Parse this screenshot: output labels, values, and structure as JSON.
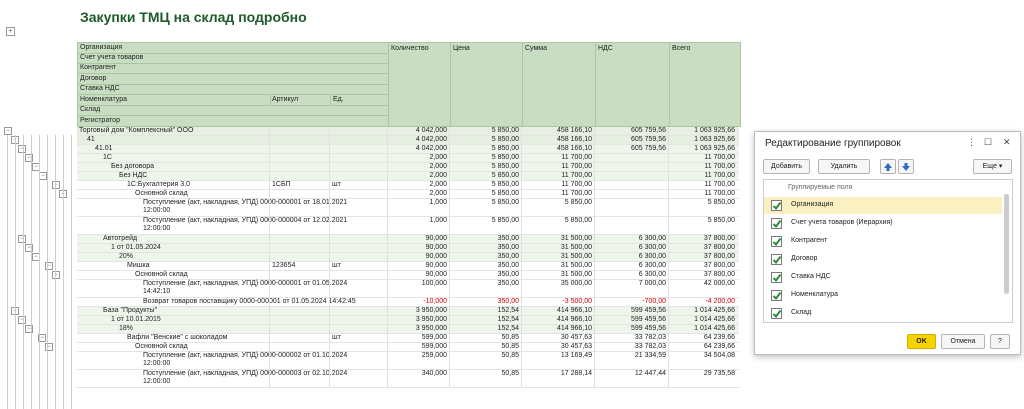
{
  "report": {
    "title": "Закупки ТМЦ на склад подробно",
    "expand_all": "+",
    "header": {
      "org": "Организация",
      "account": "Счет учета товаров",
      "counterparty": "Контрагент",
      "contract": "Договор",
      "vat_rate": "Ставка НДС",
      "nomenclature": "Номенклатура",
      "article": "Артикул",
      "unit": "Ед.",
      "warehouse": "Склад",
      "registrar": "Регистратор",
      "qty": "Количество",
      "price": "Цена",
      "sum": "Сумма",
      "vat": "НДС",
      "total": "Всего"
    }
  },
  "rows": [
    {
      "name": "Торговый дом \"Комплексный\" ООО",
      "qty": "4 042,000",
      "price": "5 850,00",
      "sum": "458 166,10",
      "vat": "605 759,56",
      "total": "1 063 925,66"
    },
    {
      "name": "41",
      "qty": "4 042,000",
      "price": "5 850,00",
      "sum": "458 166,10",
      "vat": "605 759,56",
      "total": "1 063 925,66"
    },
    {
      "name": "41.01",
      "qty": "4 042,000",
      "price": "5 850,00",
      "sum": "458 166,10",
      "vat": "605 759,56",
      "total": "1 063 925,66"
    },
    {
      "name": "1С",
      "qty": "2,000",
      "price": "5 850,00",
      "sum": "11 700,00",
      "vat": "",
      "total": "11 700,00"
    },
    {
      "name": "Без договора",
      "qty": "2,000",
      "price": "5 850,00",
      "sum": "11 700,00",
      "vat": "",
      "total": "11 700,00"
    },
    {
      "name": "Без НДС",
      "qty": "2,000",
      "price": "5 850,00",
      "sum": "11 700,00",
      "vat": "",
      "total": "11 700,00"
    },
    {
      "name": "1С:Бухгалтерия 3.0",
      "article": "1СБП",
      "unit": "шт",
      "qty": "2,000",
      "price": "5 850,00",
      "sum": "11 700,00",
      "vat": "",
      "total": "11 700,00"
    },
    {
      "name": "Основной склад",
      "qty": "2,000",
      "price": "5 850,00",
      "sum": "11 700,00",
      "vat": "",
      "total": "11 700,00"
    },
    {
      "name": "Поступление (акт, накладная, УПД) 0000-000001 от 18.01.2021",
      "name2": "12:00:00",
      "qty": "1,000",
      "price": "5 850,00",
      "sum": "5 850,00",
      "vat": "",
      "total": "5 850,00"
    },
    {
      "name": "Поступление (акт, накладная, УПД) 0000-000004 от 12.02.2021",
      "name2": "12:00:00",
      "qty": "1,000",
      "price": "5 850,00",
      "sum": "5 850,00",
      "vat": "",
      "total": "5 850,00"
    },
    {
      "name": "Автотрейд",
      "qty": "90,000",
      "price": "350,00",
      "sum": "31 500,00",
      "vat": "6 300,00",
      "total": "37 800,00"
    },
    {
      "name": "1 от 01.05.2024",
      "qty": "90,000",
      "price": "350,00",
      "sum": "31 500,00",
      "vat": "6 300,00",
      "total": "37 800,00"
    },
    {
      "name": "20%",
      "qty": "90,000",
      "price": "350,00",
      "sum": "31 500,00",
      "vat": "6 300,00",
      "total": "37 800,00"
    },
    {
      "name": "Мишка",
      "article": "123654",
      "unit": "шт",
      "qty": "90,000",
      "price": "350,00",
      "sum": "31 500,00",
      "vat": "6 300,00",
      "total": "37 800,00"
    },
    {
      "name": "Основной склад",
      "qty": "90,000",
      "price": "350,00",
      "sum": "31 500,00",
      "vat": "6 300,00",
      "total": "37 800,00"
    },
    {
      "name": "Поступление (акт, накладная, УПД) 0000-000001 от 01.05.2024",
      "name2": "14:42:10",
      "qty": "100,000",
      "price": "350,00",
      "sum": "35 000,00",
      "vat": "7 000,00",
      "total": "42 000,00"
    },
    {
      "name": "Возврат товаров поставщику 0000-000001 от 01.05.2024 14:42:45",
      "qty": "-10,000",
      "price": "350,00",
      "sum": "-3 500,00",
      "vat": "-700,00",
      "total": "-4 200,00",
      "negative": true
    },
    {
      "name": "База \"Продукты\"",
      "qty": "3 950,000",
      "price": "152,54",
      "sum": "414 966,10",
      "vat": "599 459,56",
      "total": "1 014 425,66"
    },
    {
      "name": "1 от 10.01.2015",
      "qty": "3 950,000",
      "price": "152,54",
      "sum": "414 966,10",
      "vat": "599 459,56",
      "total": "1 014 425,66"
    },
    {
      "name": "18%",
      "qty": "3 950,000",
      "price": "152,54",
      "sum": "414 966,10",
      "vat": "599 459,56",
      "total": "1 014 425,66"
    },
    {
      "name": "Вафли \"Венские\" с шоколадом",
      "article": "",
      "unit": "шт",
      "qty": "599,000",
      "price": "50,85",
      "sum": "30 457,63",
      "vat": "33 782,03",
      "total": "64 239,66"
    },
    {
      "name": "Основной склад",
      "qty": "599,000",
      "price": "50,85",
      "sum": "30 457,63",
      "vat": "33 782,03",
      "total": "64 239,66"
    },
    {
      "name": "Поступление (акт, накладная, УПД) 0000-000002 от 01.10.2024",
      "name2": "12:00:00",
      "qty": "259,000",
      "price": "50,85",
      "sum": "13 169,49",
      "vat": "21 334,59",
      "total": "34 504,08"
    },
    {
      "name": "Поступление (акт, накладная, УПД) 0000-000003 от 02.10.2024",
      "name2": "12:00:00",
      "qty": "340,000",
      "price": "50,85",
      "sum": "17 288,14",
      "vat": "12 447,44",
      "total": "29 735,58"
    }
  ],
  "dialog": {
    "title": "Редактирование группировок",
    "more_icon": "more-vertical-icon",
    "add": "Добавить",
    "delete": "Удалить",
    "more": "Еще",
    "fields_header": "Группируемые поля",
    "items": [
      {
        "label": "Организация",
        "checked": true,
        "selected": true
      },
      {
        "label": "Счет учета товаров (Иерархия)",
        "checked": true
      },
      {
        "label": "Контрагент",
        "checked": true
      },
      {
        "label": "Договор",
        "checked": true
      },
      {
        "label": "Ставка НДС",
        "checked": true
      },
      {
        "label": "Номенклатура",
        "checked": true
      },
      {
        "label": "Склад",
        "checked": true
      }
    ],
    "ok": "OK",
    "cancel": "Отмена",
    "help": "?"
  },
  "colors": {
    "header_bg": "#c9ddc2",
    "group_bg": "#e6efe2",
    "title": "#1f5a2a",
    "ok": "#f6d200",
    "check": "#2e8b3a",
    "negative": "#cc0000"
  }
}
